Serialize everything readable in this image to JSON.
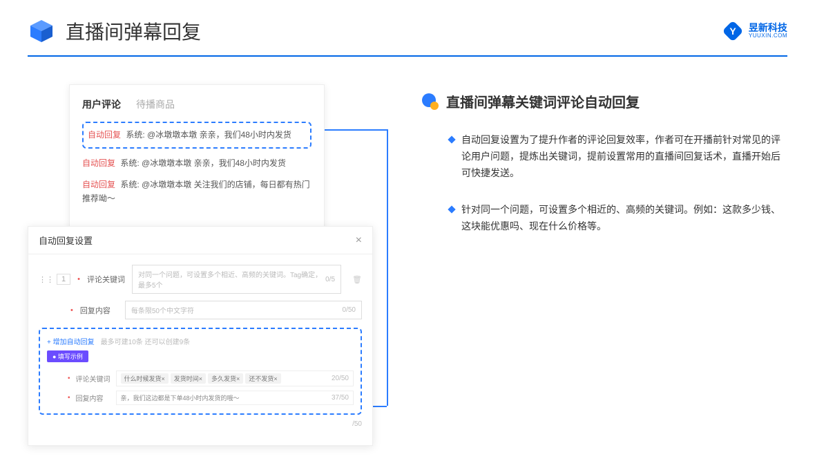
{
  "header": {
    "title": "直播间弹幕回复",
    "brand_cn": "昱新科技",
    "brand_en": "YUUXIN.COM"
  },
  "comments": {
    "tab_active": "用户评论",
    "tab_inactive": "待播商品",
    "auto_tag": "自动回复",
    "sys_prefix": "系统:",
    "row1": "@冰墩墩本墩 亲亲，我们48小时内发货",
    "row2": "@冰墩墩本墩 亲亲，我们48小时内发货",
    "row3": "@冰墩墩本墩 关注我们的店铺，每日都有热门推荐呦～"
  },
  "settings": {
    "title": "自动回复设置",
    "idx": "1",
    "label_keyword": "评论关键词",
    "placeholder_keyword": "对同一个问题，可设置多个相近、高频的关键词。Tag确定，最多5个",
    "counter_keyword": "0/5",
    "label_content": "回复内容",
    "placeholder_content": "每条限50个中文字符",
    "counter_content": "0/50",
    "add_link": "+ 增加自动回复",
    "add_hint": "最多可建10条 还可以创建9条",
    "example_badge": "● 填写示例",
    "ex_label_kw": "评论关键词",
    "ex_kw_tags": [
      "什么时候发货×",
      "发货时间×",
      "多久发货×",
      "还不发货×"
    ],
    "ex_kw_counter": "20/50",
    "ex_label_content": "回复内容",
    "ex_content_text": "亲，我们这边都是下单48小时内发货的哦～",
    "ex_content_counter": "37/50",
    "footer_counter": "/50"
  },
  "right": {
    "section_title": "直播间弹幕关键词评论自动回复",
    "bullet1": "自动回复设置为了提升作者的评论回复效率，作者可在开播前针对常见的评论用户问题，提炼出关键词，提前设置常用的直播间回复话术，直播开始后可快捷发送。",
    "bullet2": "针对同一个问题，可设置多个相近的、高频的关键词。例如：这款多少钱、这块能优惠吗、现在什么价格等。"
  }
}
